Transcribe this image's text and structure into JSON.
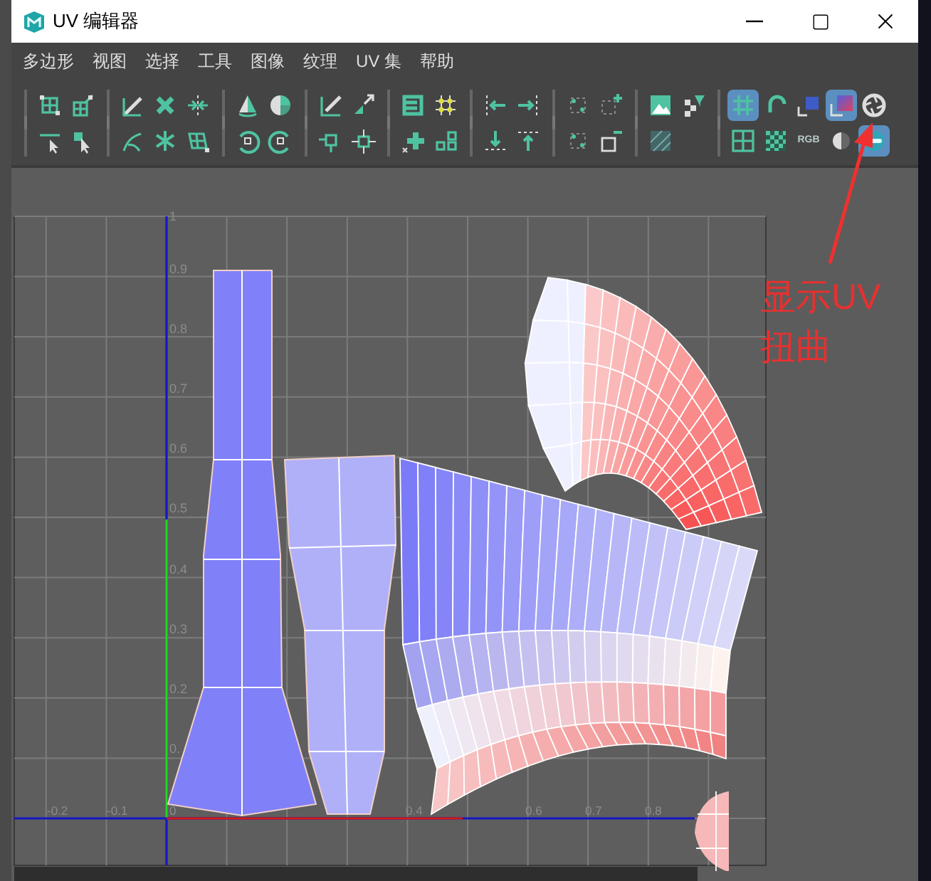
{
  "window": {
    "title": "UV 编辑器"
  },
  "menu": [
    {
      "label": "多边形"
    },
    {
      "label": "视图"
    },
    {
      "label": "选择"
    },
    {
      "label": "工具"
    },
    {
      "label": "图像"
    },
    {
      "label": "纹理"
    },
    {
      "label": "UV 集"
    },
    {
      "label": "帮助"
    }
  ],
  "display_toggles": {
    "top": [
      {
        "on": true
      },
      {
        "on": false
      },
      {
        "on": false
      },
      {
        "on": true
      },
      {
        "on": false
      }
    ],
    "bottom": [
      {
        "on": false
      },
      {
        "on": false
      },
      {
        "on": false,
        "label": "RGB"
      },
      {
        "on": false
      },
      {
        "on": true
      }
    ]
  },
  "canvas": {
    "v_labels": [
      "1",
      "0.9",
      "0.8",
      "0.7",
      "0.6",
      "0.5",
      "0.4",
      "0.3",
      "0.2",
      "0."
    ],
    "u_labels": [
      "-0.2",
      "-0.1",
      "0",
      "0.4",
      "0.6",
      "0.7",
      "0.8"
    ]
  },
  "annotation": {
    "text": "显示UV扭曲"
  }
}
